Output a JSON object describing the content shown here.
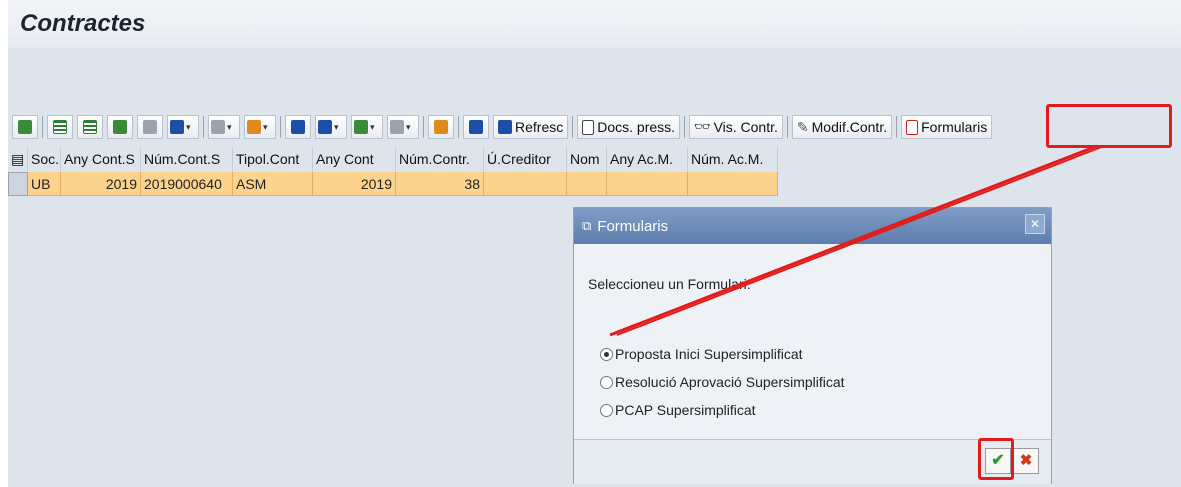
{
  "header": {
    "title": "Contractes"
  },
  "toolbar": {
    "refresh_label": "Refresc",
    "docs_label": "Docs. press.",
    "vis_label": "Vis. Contr.",
    "modif_label": "Modif.Contr.",
    "forms_label": "Formularis"
  },
  "grid": {
    "columns": [
      "Soc.",
      "Any Cont.S",
      "Núm.Cont.S",
      "Tipol.Cont",
      "Any Cont",
      "Núm.Contr.",
      "Ú.Creditor",
      "Nom",
      "Any Ac.M.",
      "Núm. Ac.M."
    ],
    "rows": [
      [
        "UB",
        "2019",
        "2019000640",
        "ASM",
        "2019",
        "38",
        "",
        "",
        "",
        ""
      ]
    ]
  },
  "dialog": {
    "title": "Formularis",
    "prompt": "Seleccioneu un Formulari:",
    "options": [
      {
        "label": "Proposta Inici Supersimplificat",
        "selected": true
      },
      {
        "label": "Resolució Aprovació Supersimplificat",
        "selected": false
      },
      {
        "label": "PCAP Supersimplificat",
        "selected": false
      }
    ]
  },
  "colors": {
    "highlight": "#e21b1b",
    "row_selected": "#fbd38d",
    "dialog_title": "#6c8bb8"
  }
}
